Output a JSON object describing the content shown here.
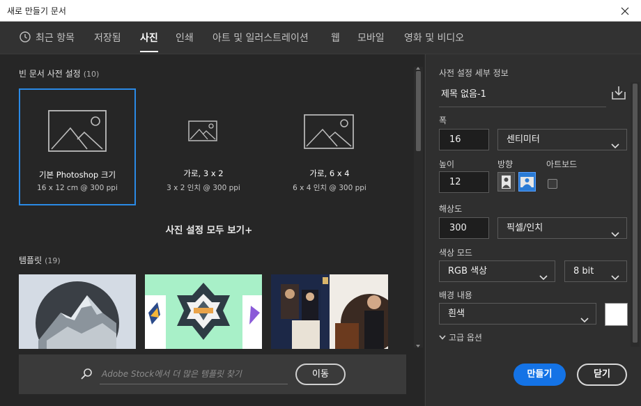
{
  "window": {
    "title": "새로 만들기 문서",
    "close_icon": "close-icon"
  },
  "tabs": [
    {
      "label": "최근 항목",
      "active": false
    },
    {
      "label": "저장됨",
      "active": false
    },
    {
      "label": "사진",
      "active": true
    },
    {
      "label": "인쇄",
      "active": false
    },
    {
      "label": "아트 및 일러스트레이션",
      "active": false
    },
    {
      "label": "웹",
      "active": false
    },
    {
      "label": "모바일",
      "active": false
    },
    {
      "label": "영화 및 비디오",
      "active": false
    }
  ],
  "presets_section": {
    "title": "빈 문서 사전 설정",
    "count": "(10)",
    "items": [
      {
        "name": "기본 Photoshop 크기",
        "size": "16 x 12 cm @ 300 ppi",
        "selected": true
      },
      {
        "name": "가로, 3 x 2",
        "size": "3 x 2 인치 @ 300 ppi",
        "selected": false
      },
      {
        "name": "가로, 6 x 4",
        "size": "6 x 4 인치 @ 300 ppi",
        "selected": false
      }
    ],
    "see_all": "사진 설정 모두 보기+"
  },
  "templates_section": {
    "title": "템플릿",
    "count": "(19)"
  },
  "stock_search": {
    "placeholder": "Adobe Stock에서 더 많은 템플릿 찾기",
    "go_label": "이동"
  },
  "details": {
    "title": "사전 설정 세부 정보",
    "doc_name": "제목 없음-1",
    "width_label": "폭",
    "width_value": "16",
    "width_unit": "센티미터",
    "height_label": "높이",
    "height_value": "12",
    "orientation_label": "방향",
    "artboard_label": "아트보드",
    "resolution_label": "해상도",
    "resolution_value": "300",
    "resolution_unit": "픽셀/인치",
    "color_mode_label": "색상 모드",
    "color_mode_value": "RGB 색상",
    "bit_depth_value": "8 bit",
    "background_label": "배경 내용",
    "background_value": "흰색",
    "background_swatch": "#ffffff",
    "advanced_label": "고급 옵션",
    "create_label": "만들기",
    "close_label": "닫기"
  },
  "colors": {
    "accent": "#1473e6",
    "selection": "#2a8ae6"
  }
}
